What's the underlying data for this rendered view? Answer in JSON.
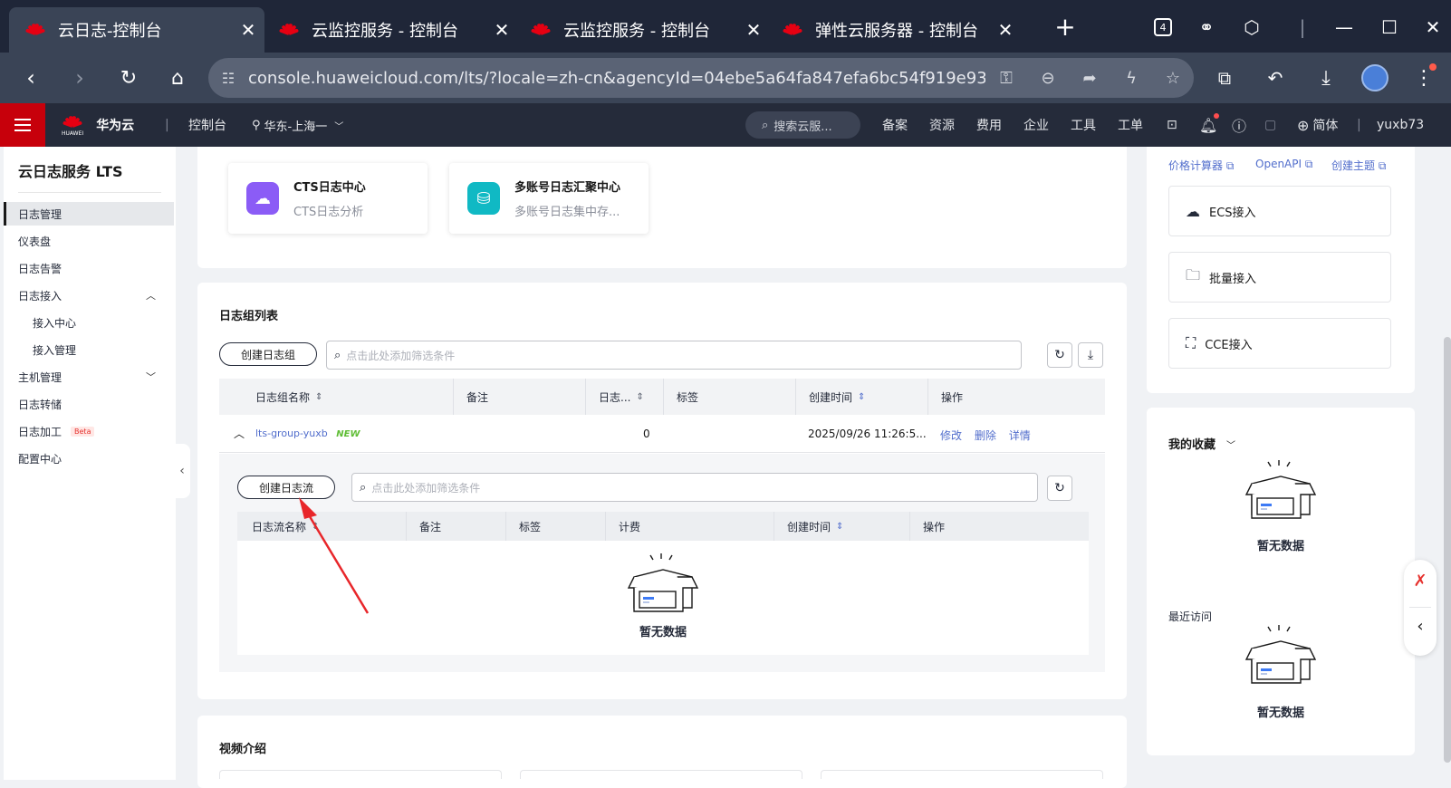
{
  "browser": {
    "tabs": [
      {
        "title": "云日志-控制台",
        "active": true
      },
      {
        "title": "云监控服务 - 控制台",
        "active": false
      },
      {
        "title": "云监控服务 - 控制台",
        "active": false
      },
      {
        "title": "弹性云服务器 - 控制台",
        "active": false
      }
    ],
    "new_tab": "+",
    "tab_count_badge": "4",
    "url": "console.huaweicloud.com/lts/?locale=zh-cn&agencyId=04ebe5a64fa847efa6bc54f919e93..."
  },
  "header": {
    "brand": "华为云",
    "brand_sub": "HUAWEI",
    "console": "控制台",
    "region": "华东-上海一",
    "search_placeholder": "搜索云服...",
    "nav": [
      "备案",
      "资源",
      "费用",
      "企业",
      "工具",
      "工单"
    ],
    "language": "简体",
    "user": "yuxb73"
  },
  "sidebar": {
    "title": "云日志服务 LTS",
    "items": [
      {
        "label": "日志管理",
        "active": true
      },
      {
        "label": "仪表盘"
      },
      {
        "label": "日志告警"
      },
      {
        "label": "日志接入"
      },
      {
        "label": "接入中心"
      },
      {
        "label": "接入管理"
      },
      {
        "label": "主机管理"
      },
      {
        "label": "日志转储"
      },
      {
        "label": "日志加工"
      },
      {
        "label": "配置中心"
      }
    ],
    "beta": "Beta"
  },
  "services": [
    {
      "name": "CTS日志中心",
      "desc": "CTS日志分析",
      "color": "#8b5cf6"
    },
    {
      "name": "多账号日志汇聚中心",
      "desc": "多账号日志集中存...",
      "color": "#10b9c4"
    }
  ],
  "loggroups": {
    "title": "日志组列表",
    "create_btn": "创建日志组",
    "search_placeholder": "点击此处添加筛选条件",
    "columns": [
      "日志组名称",
      "备注",
      "日志...",
      "标签",
      "创建时间",
      "操作"
    ],
    "row": {
      "name": "lts-group-yuxb",
      "badge": "NEW",
      "count": "0",
      "created": "2025/09/26 11:26:5...",
      "actions": [
        "修改",
        "删除",
        "详情"
      ]
    }
  },
  "logstreams": {
    "create_btn": "创建日志流",
    "search_placeholder": "点击此处添加筛选条件",
    "columns": [
      "日志流名称",
      "备注",
      "标签",
      "计费",
      "创建时间",
      "操作"
    ],
    "empty": "暂无数据"
  },
  "video": {
    "title": "视频介绍"
  },
  "right": {
    "links": [
      "价格计算器",
      "OpenAPI",
      "创建主题"
    ],
    "buttons": [
      "ECS接入",
      "批量接入",
      "CCE接入"
    ],
    "favorites_title": "我的收藏",
    "favorites_empty": "暂无数据",
    "recent_title": "最近访问",
    "recent_empty": "暂无数据"
  },
  "colors": {
    "brand_red": "#c7000b",
    "link_blue": "#526ecc",
    "header_bg": "#252b3a",
    "annotation_arrow": "#e8262a"
  }
}
